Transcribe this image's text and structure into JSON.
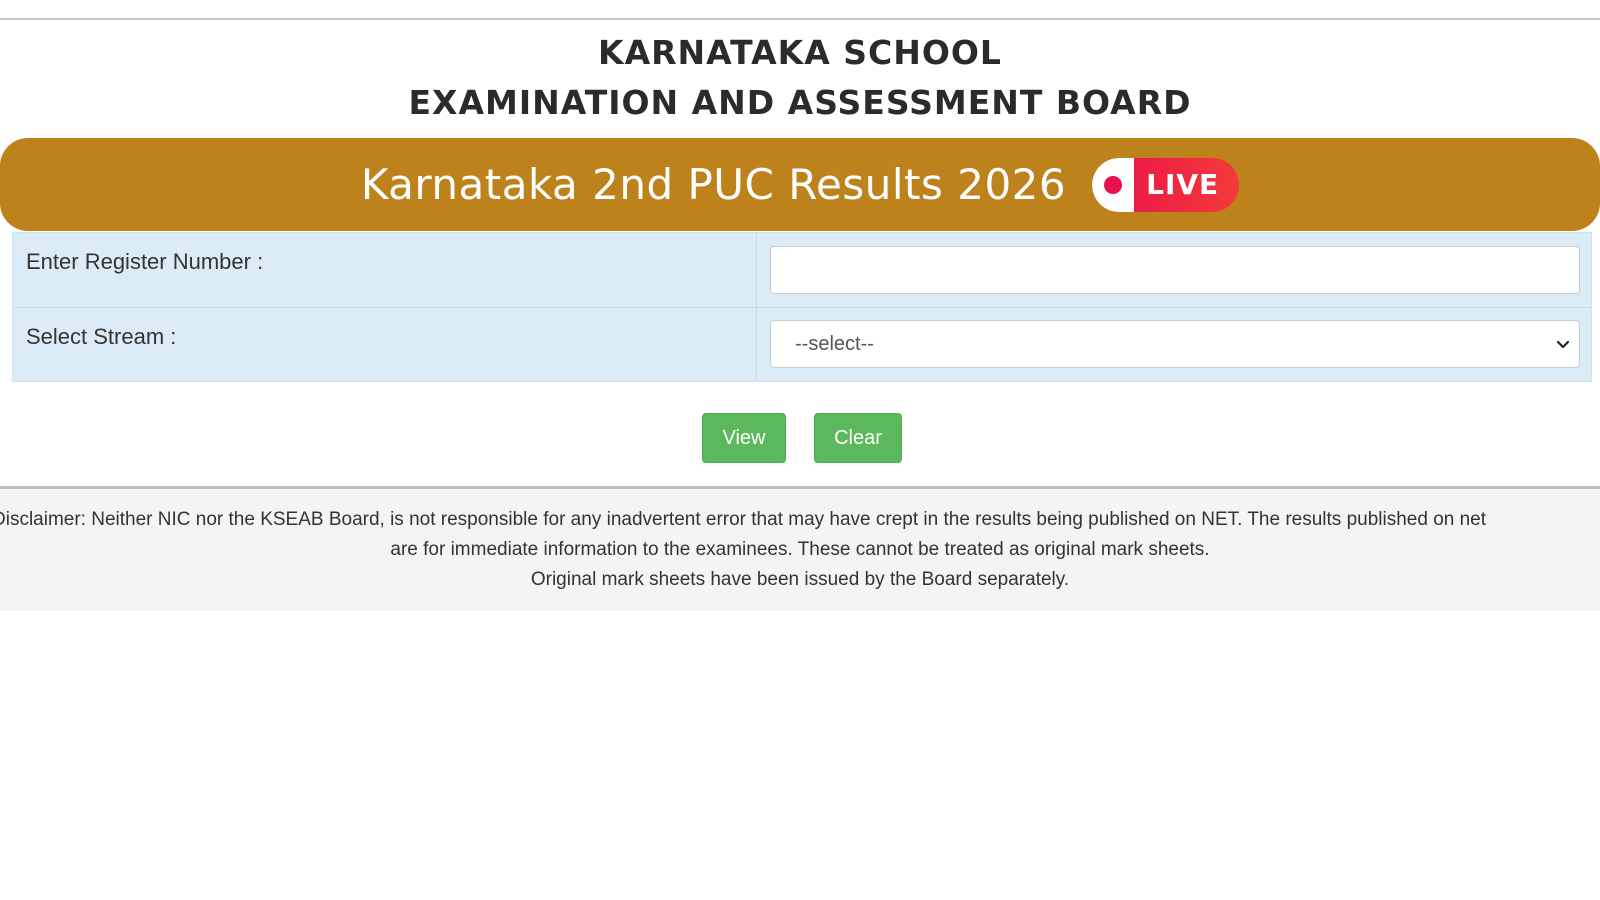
{
  "header": {
    "title_line1": "KARNATAKA SCHOOL",
    "title_line2": "EXAMINATION AND ASSESSMENT BOARD"
  },
  "banner": {
    "title": "Karnataka 2nd PUC Results 2026",
    "live_label": "LIVE",
    "colors": {
      "background": "#be821c",
      "live_badge": "#e8114b"
    }
  },
  "form": {
    "register_label": "Enter Register Number :",
    "register_value": "",
    "stream_label": "Select Stream :",
    "stream_selected": "--select--"
  },
  "buttons": {
    "view_label": "View",
    "clear_label": "Clear",
    "color": "#5cb85c"
  },
  "disclaimer": {
    "line1": "Disclaimer: Neither NIC nor the KSEAB Board, is not responsible for any inadvertent error that may have crept in the results being published on NET. The results published on net",
    "line2": "are for immediate information to the examinees. These cannot be treated as original mark sheets.",
    "line3": "Original mark sheets have been issued by the Board separately."
  }
}
